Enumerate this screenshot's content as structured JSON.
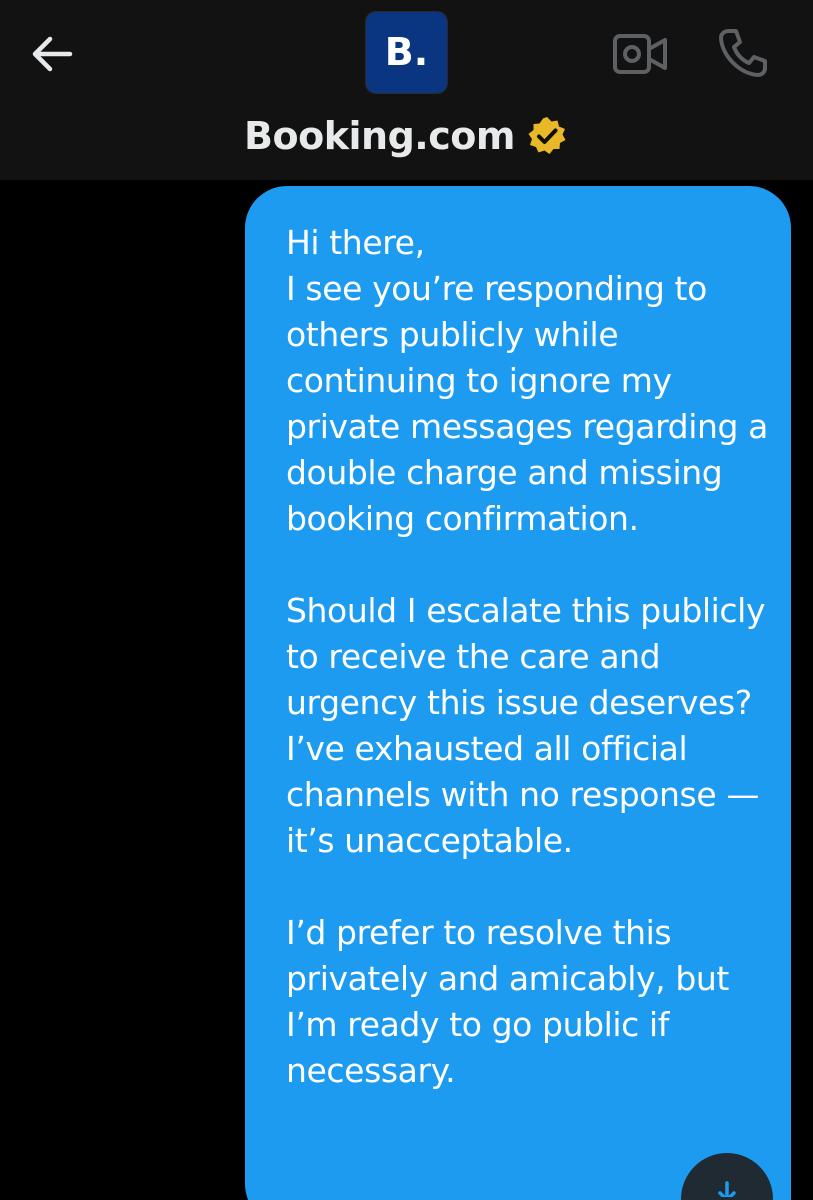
{
  "header": {
    "title": "Booking.com",
    "avatar_text": "B.",
    "back_icon": "arrow-left-icon",
    "video_icon": "video-camera-icon",
    "call_icon": "phone-icon",
    "verified_icon": "verified-badge-icon",
    "verified_color": "#e8b829",
    "brand_color": "#0a3580"
  },
  "conversation": {
    "bubble_color": "#1d9bf0",
    "message": {
      "paragraphs": [
        "Hi there,\nI see you’re responding to others publicly while continuing to ignore my private messages regarding a double charge and missing booking confirmation.",
        "Should I escalate this publicly to receive the care and urgency this issue deserves? I’ve exhausted all official channels with no response — it’s unacceptable.",
        "I’d prefer to resolve this privately and amicably, but I’m ready to go public if necessary."
      ]
    }
  },
  "scroll_button": {
    "icon": "arrow-down-icon"
  }
}
